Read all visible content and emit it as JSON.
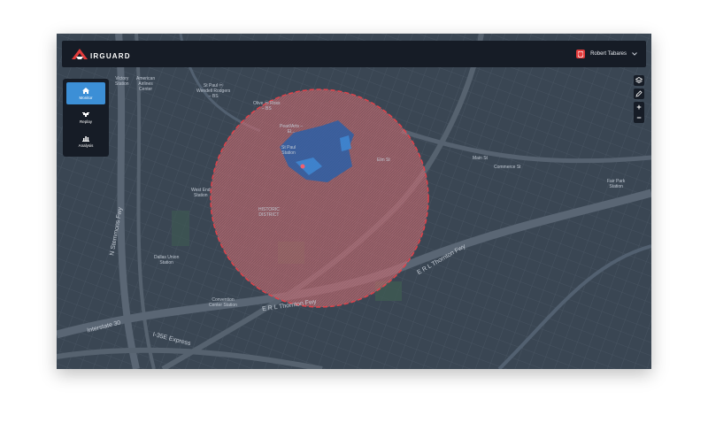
{
  "app": {
    "name": "IRGUARD",
    "logo_letter": "A"
  },
  "colors": {
    "topbar": "#161c26",
    "map_bg": "#3a4653",
    "accent": "#3c8fd6",
    "zone": "#c9666c",
    "brand": "#e23b3b"
  },
  "user": {
    "name": "Robert Tabares",
    "badge_icon": "shield-icon",
    "menu_icon": "chevron-down-icon"
  },
  "nav": {
    "items": [
      {
        "label": "Monitor",
        "icon": "home-icon",
        "active": true
      },
      {
        "label": "Replay",
        "icon": "drone-icon",
        "active": false
      },
      {
        "label": "Analysis",
        "icon": "chart-icon",
        "active": false
      }
    ]
  },
  "tools": {
    "layers_icon": "layers-icon",
    "edit_icon": "pencil-icon",
    "zoom_in": "+",
    "zoom_out": "−"
  },
  "map": {
    "labels": {
      "victory": "Victory\nStation",
      "american": "American\nAirlines\nCenter",
      "st_paul": "St Paul ⓜ\nWendell Rodgers\n– BS",
      "olive": "Olive ⓜ Ross\n– BS",
      "pearl": "Pearl/Arts –\nEl...",
      "st_paul_station": "St Paul\nStation",
      "west_end": "West End\nStation",
      "historic": "HISTORIC\nDISTRICT",
      "dallas_union": "Dallas Union\nStation",
      "convention": "Convention\nCenter Station",
      "fair_park": "Fair Park\nStation",
      "elm": "Elm St",
      "main": "Main St",
      "commerce": "Commerce St"
    },
    "roads": {
      "stemmons": "N Stemmons Fwy",
      "thornton1": "E R L Thornton Fwy",
      "thornton2": "E R L Thornton Fwy",
      "express": "I-35E Express",
      "interstate": "Interstate 30"
    }
  }
}
